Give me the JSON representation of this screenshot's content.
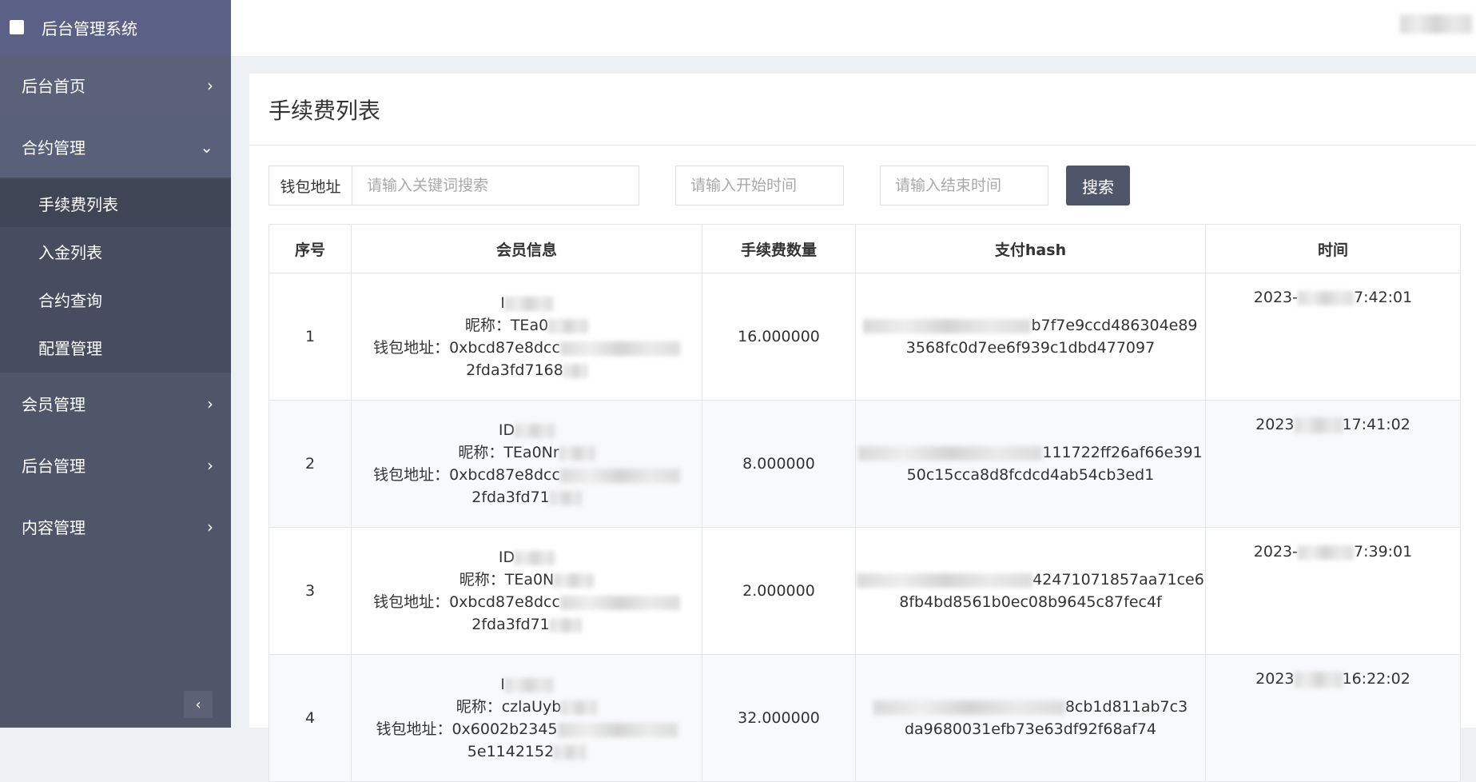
{
  "app": {
    "title": "后台管理系统"
  },
  "sidebar": {
    "items": [
      {
        "label": "后台首页",
        "chevron": "›"
      },
      {
        "label": "合约管理",
        "chevron": "⌄"
      },
      {
        "label": "会员管理",
        "chevron": "›"
      },
      {
        "label": "后台管理",
        "chevron": "›"
      },
      {
        "label": "内容管理",
        "chevron": "›"
      }
    ],
    "submenu": [
      {
        "label": "手续费列表"
      },
      {
        "label": "入金列表"
      },
      {
        "label": "合约查询"
      },
      {
        "label": "配置管理"
      }
    ],
    "collapse_icon": "‹"
  },
  "page": {
    "title": "手续费列表"
  },
  "filters": {
    "wallet_label": "钱包地址",
    "keyword_placeholder": "请输入关键词搜索",
    "start_placeholder": "请输入开始时间",
    "end_placeholder": "请输入结束时间",
    "search_label": "搜索"
  },
  "table": {
    "headers": [
      "序号",
      "会员信息",
      "手续费数量",
      "支付hash",
      "时间"
    ],
    "rows": [
      {
        "index": "1",
        "id_line": "I",
        "nickname": "昵称：TEa0",
        "wallet1": "钱包地址：0xbcd87e8dcc",
        "wallet2": "2fda3fd7168",
        "fee": "16.000000",
        "hash1": "b7f7e9ccd486304e89",
        "hash2": "3568fc0d7ee6f939c1dbd477097",
        "time_start": "2023-",
        "time_end": "7:42:01"
      },
      {
        "index": "2",
        "id_line": "ID",
        "nickname": "昵称：TEa0Nr",
        "wallet1": "钱包地址：0xbcd87e8dcc",
        "wallet2": "2fda3fd71",
        "fee": "8.000000",
        "hash1": "111722ff26af66e391",
        "hash2": "50c15cca8d8fcdcd4ab54cb3ed1",
        "time_start": "2023",
        "time_end": "17:41:02"
      },
      {
        "index": "3",
        "id_line": "ID",
        "nickname": "昵称：TEa0N",
        "wallet1": "钱包地址：0xbcd87e8dcc",
        "wallet2": "2fda3fd71",
        "fee": "2.000000",
        "hash1": "42471071857aa71ce6",
        "hash2": "8fb4bd8561b0ec08b9645c87fec4f",
        "time_start": "2023-",
        "time_end": "7:39:01"
      },
      {
        "index": "4",
        "id_line": "I",
        "nickname": "昵称：czlaUyb",
        "wallet1": "钱包地址：0x6002b2345",
        "wallet2": "5e1142152",
        "fee": "32.000000",
        "hash1": "8cb1d811ab7c3",
        "hash2": "da9680031efb73e63df92f68af74",
        "time_start": "2023",
        "time_end": "16:22:02"
      }
    ]
  }
}
